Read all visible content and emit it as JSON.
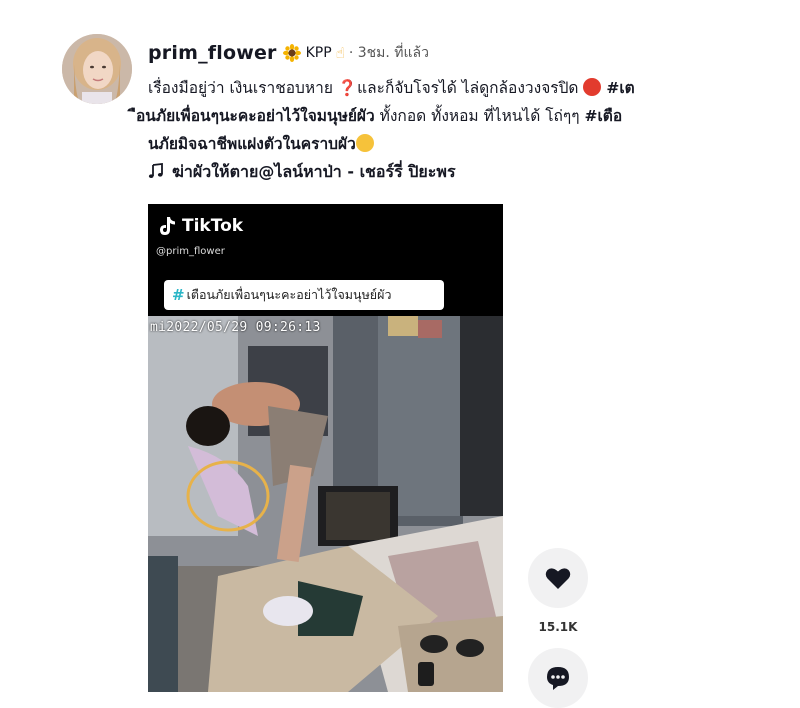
{
  "post": {
    "username": "prim_flower",
    "nickname": "KPP",
    "time_ago": "· 3ชม. ที่แล้ว",
    "caption": {
      "line1_text": "เรื่องมือยู่ว่า เงินเราชอบหาย ",
      "line1_mid": "และก็จับโจรได้ ไล่ดูกล้องวงจรปิด ",
      "line1_tag": "#เต",
      "line2_bold": "ือนภัยเพื่อนๆนะคะอย่าไว้ใจมนุษย์ผัว",
      "line2_text": " ทั้งกอด ทั้งหอม ที่ไหนได้ โถ่ๆๆ ",
      "line2_tag": "#เตือ",
      "line3_bold": "นภัยมิจฉาชีพแฝงตัวในคราบผัว"
    },
    "music": "ฆ่าผัวให้ตาย@ไลน์หาป่า - เชอร์รี่ ปิยะพร"
  },
  "video": {
    "brand": "TikTok",
    "handle": "@prim_flower",
    "overlay_tag": "เตือนภัยเพื่อนๆนะคะอย่าไว้ใจมนุษย์ผัว",
    "cctv_timestamp": "2022/05/29  09:26:13"
  },
  "actions": {
    "like_count": "15.1K",
    "like_icon": "heart-icon",
    "comment_icon": "comment-icon"
  },
  "colors": {
    "text": "#161823",
    "action_bg": "#f1f1f2",
    "hashtag_accent": "#2bb6c7"
  }
}
